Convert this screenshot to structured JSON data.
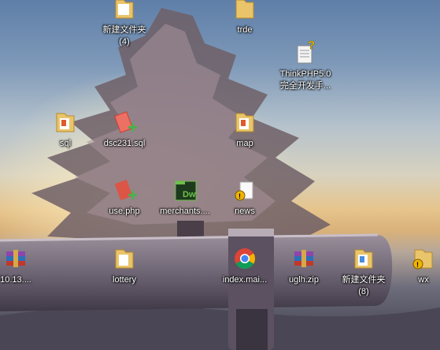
{
  "desktop": {
    "icons": [
      {
        "label": "新建文件夹\n(4)",
        "kind": "folder-icon"
      },
      {
        "label": "trde",
        "kind": "folder-icon"
      },
      {
        "label": "ThinkPHP5.0\n完全开发手...",
        "kind": "unknown-file-icon"
      },
      {
        "label": "sql",
        "kind": "folder-icon"
      },
      {
        "label": "dsc231.sql",
        "kind": "sql-file-icon"
      },
      {
        "label": "map",
        "kind": "folder-icon"
      },
      {
        "label": "use.php",
        "kind": "php-file-icon"
      },
      {
        "label": "merchants....",
        "kind": "dreamweaver-file-icon"
      },
      {
        "label": "news",
        "kind": "folder-warning-icon"
      },
      {
        "label": "10.13....",
        "kind": "rar-archive-icon"
      },
      {
        "label": "lottery",
        "kind": "folder-icon"
      },
      {
        "label": "index.mai...",
        "kind": "chrome-html-icon"
      },
      {
        "label": "uglh.zip",
        "kind": "rar-archive-icon"
      },
      {
        "label": "新建文件夹\n(8)",
        "kind": "folder-icon"
      },
      {
        "label": "wx",
        "kind": "folder-warning-icon"
      }
    ]
  }
}
